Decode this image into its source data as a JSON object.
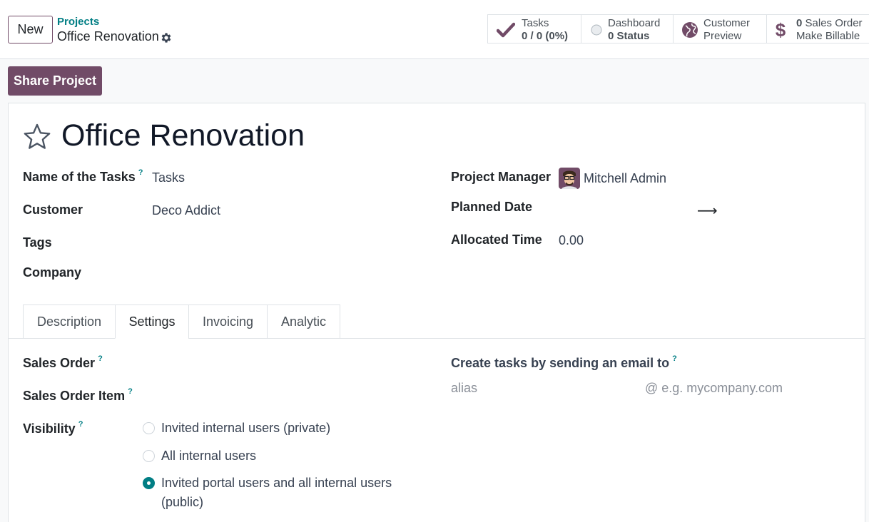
{
  "control_panel": {
    "new_label": "New",
    "breadcrumb_parent": "Projects",
    "breadcrumb_current": "Office Renovation"
  },
  "stat_buttons": {
    "tasks": {
      "line1": "Tasks",
      "line2": "0 / 0 (0%)"
    },
    "dashboard": {
      "line1": "Dashboard",
      "line2_value": "0",
      "line2_label": "Status"
    },
    "customer_preview": {
      "line1": "Customer",
      "line2": "Preview"
    },
    "sales_order": {
      "line1_value": "0",
      "line1_label": "Sales Order",
      "line2": "Make Billable"
    }
  },
  "share_label": "Share Project",
  "record": {
    "title": "Office Renovation",
    "fields_left": {
      "tasks_name_label": "Name of the Tasks",
      "tasks_name_value": "Tasks",
      "customer_label": "Customer",
      "customer_value": "Deco Addict",
      "tags_label": "Tags",
      "company_label": "Company"
    },
    "fields_right": {
      "manager_label": "Project Manager",
      "manager_value": "Mitchell Admin",
      "planned_date_label": "Planned Date",
      "allocated_time_label": "Allocated Time",
      "allocated_time_value": "0.00"
    }
  },
  "help_mark": "?",
  "tabs": [
    "Description",
    "Settings",
    "Invoicing",
    "Analytic"
  ],
  "active_tab": "Settings",
  "settings": {
    "sales_order_label": "Sales Order",
    "sales_order_item_label": "Sales Order Item",
    "visibility_label": "Visibility",
    "visibility_options": [
      {
        "label": "Invited internal users (private)",
        "checked": false
      },
      {
        "label": "All internal users",
        "checked": false
      },
      {
        "label": "Invited portal users and all internal users (public)",
        "checked": true
      }
    ],
    "email_label": "Create tasks by sending an email to",
    "alias_placeholder": "alias",
    "domain_placeholder": "@ e.g. mycompany.com"
  },
  "colors": {
    "brand": "#714b67",
    "link": "#017e84"
  },
  "icons": {
    "tasks": "check-icon",
    "dashboard": "circle-status-icon",
    "customer_preview": "globe-icon",
    "sales_order": "dollar-icon",
    "settings": "gear-icon",
    "favorite": "star-icon",
    "planned_date": "arrow-right-icon"
  }
}
